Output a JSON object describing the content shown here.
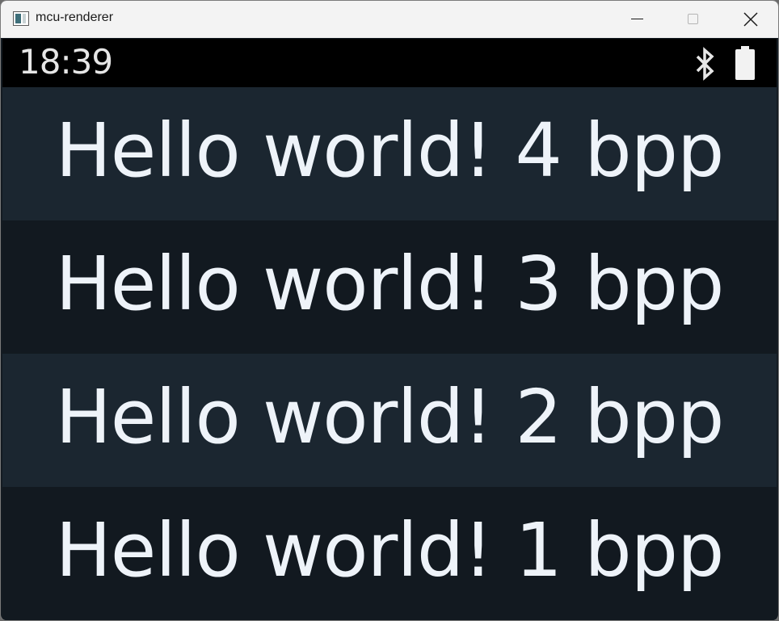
{
  "window": {
    "title": "mcu-renderer"
  },
  "status_bar": {
    "time": "18:39",
    "icons": [
      "bluetooth-icon",
      "battery-icon"
    ]
  },
  "rows": [
    {
      "label": "Hello world! 4 bpp"
    },
    {
      "label": "Hello world! 3 bpp"
    },
    {
      "label": "Hello world! 2 bpp"
    },
    {
      "label": "Hello world! 1 bpp"
    }
  ],
  "colors": {
    "row_light": "#1b2630",
    "row_dark": "#121920",
    "text": "#eef3f9",
    "status_bg": "#000000"
  }
}
